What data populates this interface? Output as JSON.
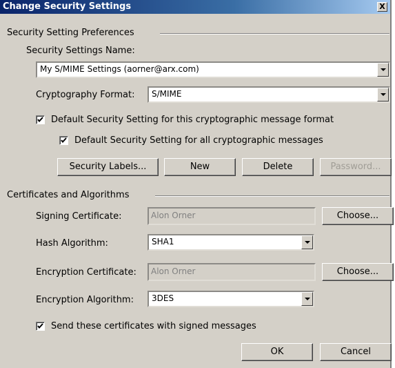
{
  "dialog": {
    "title": "Change Security Settings",
    "close_glyph": "X"
  },
  "preferences": {
    "group_label": "Security Setting Preferences",
    "name_label": "Security Settings Name:",
    "name_value": "My S/MIME Settings (aorner@arx.com)",
    "format_label": "Cryptography Format:",
    "format_value": "S/MIME",
    "default_format_label": "Default Security Setting for this cryptographic message format",
    "default_format_checked": true,
    "default_all_label": "Default Security Setting for all cryptographic messages",
    "default_all_checked": true,
    "buttons": {
      "security_labels": "Security Labels...",
      "new": "New",
      "delete": "Delete",
      "password": "Password..."
    }
  },
  "certificates": {
    "group_label": "Certificates and Algorithms",
    "signing_label": "Signing Certificate:",
    "signing_value": "Alon Orner",
    "choose_label": "Choose...",
    "hash_label": "Hash Algorithm:",
    "hash_value": "SHA1",
    "enc_cert_label": "Encryption Certificate:",
    "enc_cert_value": "Alon Orner",
    "enc_alg_label": "Encryption Algorithm:",
    "enc_alg_value": "3DES",
    "send_certs_label": "Send these certificates with signed messages",
    "send_certs_checked": true
  },
  "footer": {
    "ok": "OK",
    "cancel": "Cancel"
  }
}
